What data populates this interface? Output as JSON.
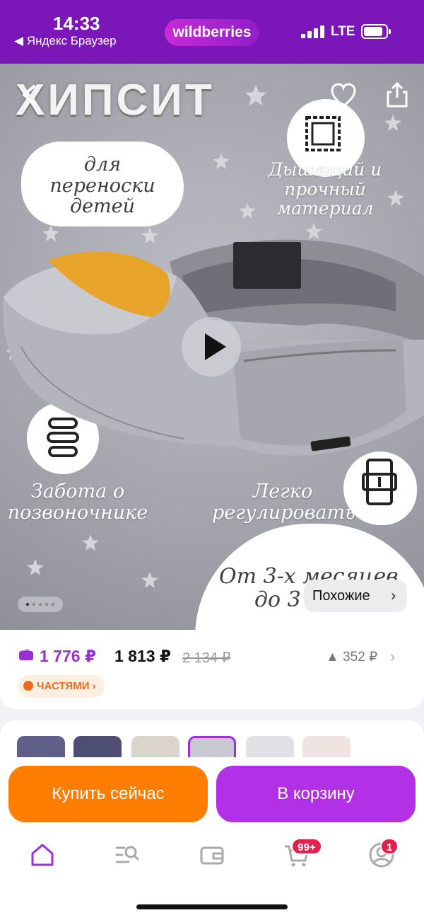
{
  "status_bar": {
    "time": "14:33",
    "back_app": "◀ Яндекс Браузер",
    "brand": "wildberries",
    "network": "LTE",
    "bg_color": "#7b16b8"
  },
  "hero": {
    "title": "ХИПСИТ",
    "caption_carry": [
      "для переноски",
      "детей"
    ],
    "caption_material": [
      "Дышащий и",
      "прочный",
      "материал"
    ],
    "caption_spine": [
      "Забота о",
      "позвоночнике"
    ],
    "caption_adjust": [
      "Легко",
      "регулировать"
    ],
    "caption_age": [
      "От 3-х месяцев",
      "до 3"
    ],
    "similar_label": "Похожие",
    "icons": [
      "back-icon",
      "heart-icon",
      "share-icon",
      "play-icon",
      "fabric-icon",
      "spine-icon",
      "belt-icon"
    ]
  },
  "price": {
    "wallet_price": "1 776 ₽",
    "price": "1 813 ₽",
    "old_price": "2 134 ₽",
    "rise": "▲ 352 ₽",
    "installments": "ЧАСТЯМИ",
    "wallet_color": "#9b2fd6"
  },
  "actions": {
    "buy_now": "Купить сейчас",
    "add_to_cart": "В корзину",
    "buy_color": "#ff7d00",
    "cart_color": "#b230e6"
  },
  "tabbar": {
    "items": [
      "home-icon",
      "catalog-search-icon",
      "wallet-icon",
      "cart-icon",
      "profile-icon"
    ],
    "cart_badge": "99+",
    "profile_badge": "1"
  }
}
